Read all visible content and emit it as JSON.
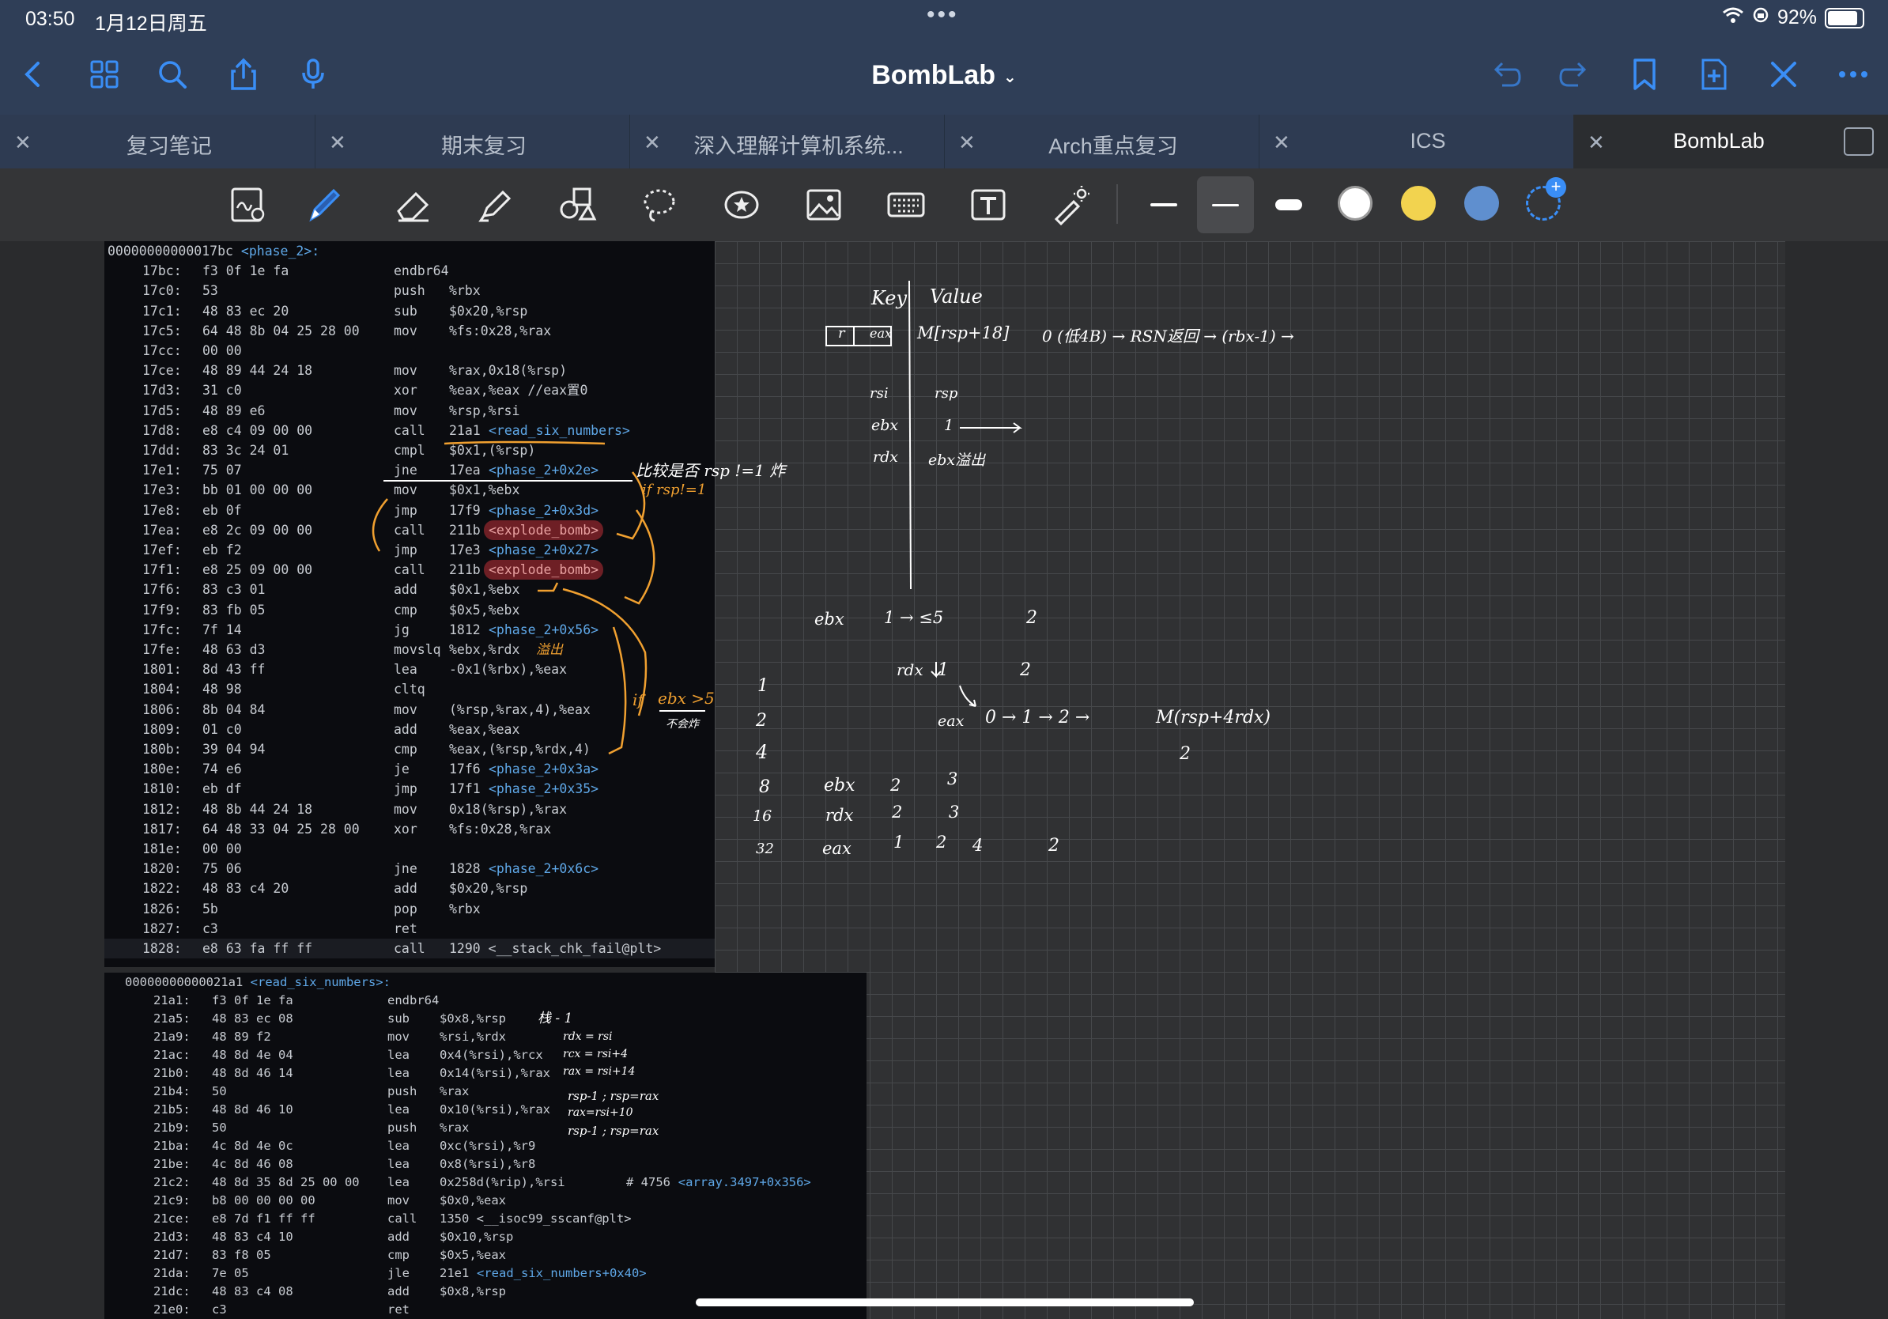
{
  "status": {
    "time": "03:50",
    "date": "1月12日周五",
    "battery": "92%",
    "battery_level": 0.92
  },
  "app": {
    "doc_title": "BombLab",
    "accent": "#3a8ef6"
  },
  "nav": {
    "left_icons": [
      "back-chevron-icon",
      "grid-icon",
      "search-icon",
      "share-icon",
      "microphone-icon"
    ],
    "right_icons": [
      "undo-icon",
      "redo-icon",
      "bookmark-icon",
      "add-page-icon",
      "close-x-icon",
      "more-icon"
    ]
  },
  "tabs": [
    {
      "label": "复习笔记",
      "active": false
    },
    {
      "label": "期末复习",
      "active": false
    },
    {
      "label": "深入理解计算机系统...",
      "active": false
    },
    {
      "label": "Arch重点复习",
      "active": false
    },
    {
      "label": "ICS",
      "active": false
    },
    {
      "label": "BombLab",
      "active": true
    }
  ],
  "toolbar": {
    "tools": [
      "page-zoom-icon",
      "pen-icon",
      "eraser-icon",
      "highlighter-icon",
      "shapes-icon",
      "lasso-icon",
      "stickers-icon",
      "image-icon",
      "keyboard-icon",
      "text-icon",
      "laser-pointer-icon"
    ],
    "colors": [
      "#ffffff",
      "#f2d34f",
      "#5f8fcf"
    ]
  },
  "code1": {
    "header_addr": "00000000000017bc",
    "header_sym": "<phase_2>:",
    "lines": [
      {
        "a": "17bc:",
        "b": "f3 0f 1e fa",
        "m": "endbr64",
        "o": ""
      },
      {
        "a": "17c0:",
        "b": "53",
        "m": "push",
        "o": "%rbx"
      },
      {
        "a": "17c1:",
        "b": "48 83 ec 20",
        "m": "sub",
        "o": "$0x20,%rsp"
      },
      {
        "a": "17c5:",
        "b": "64 48 8b 04 25 28 00",
        "m": "mov",
        "o": "%fs:0x28,%rax"
      },
      {
        "a": "17cc:",
        "b": "00 00",
        "m": "",
        "o": ""
      },
      {
        "a": "17ce:",
        "b": "48 89 44 24 18",
        "m": "mov",
        "o": "%rax,0x18(%rsp)"
      },
      {
        "a": "17d3:",
        "b": "31 c0",
        "m": "xor",
        "o": "%eax,%eax //eax置0"
      },
      {
        "a": "17d5:",
        "b": "48 89 e6",
        "m": "mov",
        "o": "%rsp,%rsi"
      },
      {
        "a": "17d8:",
        "b": "e8 c4 09 00 00",
        "m": "call",
        "o": "21a1",
        "s": "<read_six_numbers>"
      },
      {
        "a": "17dd:",
        "b": "83 3c 24 01",
        "m": "cmpl",
        "o": "$0x1,(%rsp)"
      },
      {
        "a": "17e1:",
        "b": "75 07",
        "m": "jne",
        "o": "17ea",
        "s": "<phase_2+0x2e>"
      },
      {
        "a": "17e3:",
        "b": "bb 01 00 00 00",
        "m": "mov",
        "o": "$0x1,%ebx"
      },
      {
        "a": "17e8:",
        "b": "eb 0f",
        "m": "jmp",
        "o": "17f9",
        "s": "<phase_2+0x3d>"
      },
      {
        "a": "17ea:",
        "b": "e8 2c 09 00 00",
        "m": "call",
        "o": "211b",
        "x": "<explode_bomb>"
      },
      {
        "a": "17ef:",
        "b": "eb f2",
        "m": "jmp",
        "o": "17e3",
        "s": "<phase_2+0x27>"
      },
      {
        "a": "17f1:",
        "b": "e8 25 09 00 00",
        "m": "call",
        "o": "211b",
        "x": "<explode_bomb>"
      },
      {
        "a": "17f6:",
        "b": "83 c3 01",
        "m": "add",
        "o": "$0x1,%ebx"
      },
      {
        "a": "17f9:",
        "b": "83 fb 05",
        "m": "cmp",
        "o": "$0x5,%ebx"
      },
      {
        "a": "17fc:",
        "b": "7f 14",
        "m": "jg",
        "o": "1812",
        "s": "<phase_2+0x56>"
      },
      {
        "a": "17fe:",
        "b": "48 63 d3",
        "m": "movslq",
        "o": "%ebx,%rdx"
      },
      {
        "a": "1801:",
        "b": "8d 43 ff",
        "m": "lea",
        "o": "-0x1(%rbx),%eax"
      },
      {
        "a": "1804:",
        "b": "48 98",
        "m": "cltq",
        "o": ""
      },
      {
        "a": "1806:",
        "b": "8b 04 84",
        "m": "mov",
        "o": "(%rsp,%rax,4),%eax"
      },
      {
        "a": "1809:",
        "b": "01 c0",
        "m": "add",
        "o": "%eax,%eax"
      },
      {
        "a": "180b:",
        "b": "39 04 94",
        "m": "cmp",
        "o": "%eax,(%rsp,%rdx,4)"
      },
      {
        "a": "180e:",
        "b": "74 e6",
        "m": "je",
        "o": "17f6",
        "s": "<phase_2+0x3a>"
      },
      {
        "a": "1810:",
        "b": "eb df",
        "m": "jmp",
        "o": "17f1",
        "s": "<phase_2+0x35>"
      },
      {
        "a": "1812:",
        "b": "48 8b 44 24 18",
        "m": "mov",
        "o": "0x18(%rsp),%rax"
      },
      {
        "a": "1817:",
        "b": "64 48 33 04 25 28 00",
        "m": "xor",
        "o": "%fs:0x28,%rax"
      },
      {
        "a": "181e:",
        "b": "00 00",
        "m": "",
        "o": ""
      },
      {
        "a": "1820:",
        "b": "75 06",
        "m": "jne",
        "o": "1828",
        "s": "<phase_2+0x6c>"
      },
      {
        "a": "1822:",
        "b": "48 83 c4 20",
        "m": "add",
        "o": "$0x20,%rsp"
      },
      {
        "a": "1826:",
        "b": "5b",
        "m": "pop",
        "o": "%rbx"
      },
      {
        "a": "1827:",
        "b": "c3",
        "m": "ret",
        "o": ""
      },
      {
        "a": "1828:",
        "b": "e8 63 fa ff ff",
        "m": "call",
        "o": "1290 <__stack_chk_fail@plt>"
      }
    ]
  },
  "code2": {
    "header_addr": "00000000000021a1",
    "header_sym": "<read_six_numbers>:",
    "lines": [
      {
        "a": "21a1:",
        "b": "f3 0f 1e fa",
        "m": "endbr64",
        "o": ""
      },
      {
        "a": "21a5:",
        "b": "48 83 ec 08",
        "m": "sub",
        "o": "$0x8,%rsp"
      },
      {
        "a": "21a9:",
        "b": "48 89 f2",
        "m": "mov",
        "o": "%rsi,%rdx"
      },
      {
        "a": "21ac:",
        "b": "48 8d 4e 04",
        "m": "lea",
        "o": "0x4(%rsi),%rcx"
      },
      {
        "a": "21b0:",
        "b": "48 8d 46 14",
        "m": "lea",
        "o": "0x14(%rsi),%rax"
      },
      {
        "a": "21b4:",
        "b": "50",
        "m": "push",
        "o": "%rax"
      },
      {
        "a": "21b5:",
        "b": "48 8d 46 10",
        "m": "lea",
        "o": "0x10(%rsi),%rax"
      },
      {
        "a": "21b9:",
        "b": "50",
        "m": "push",
        "o": "%rax"
      },
      {
        "a": "21ba:",
        "b": "4c 8d 4e 0c",
        "m": "lea",
        "o": "0xc(%rsi),%r9"
      },
      {
        "a": "21be:",
        "b": "4c 8d 46 08",
        "m": "lea",
        "o": "0x8(%rsi),%r8"
      },
      {
        "a": "21c2:",
        "b": "48 8d 35 8d 25 00 00",
        "m": "lea",
        "o": "0x258d(%rip),%rsi",
        "c": "# 4756",
        "s": "<array.3497+0x356>"
      },
      {
        "a": "21c9:",
        "b": "b8 00 00 00 00",
        "m": "mov",
        "o": "$0x0,%eax"
      },
      {
        "a": "21ce:",
        "b": "e8 7d f1 ff ff",
        "m": "call",
        "o": "1350 <__isoc99_sscanf@plt>"
      },
      {
        "a": "21d3:",
        "b": "48 83 c4 10",
        "m": "add",
        "o": "$0x10,%rsp"
      },
      {
        "a": "21d7:",
        "b": "83 f8 05",
        "m": "cmp",
        "o": "$0x5,%eax"
      },
      {
        "a": "21da:",
        "b": "7e 05",
        "m": "jle",
        "o": "21e1",
        "s": "<read_six_numbers+0x40>"
      },
      {
        "a": "21dc:",
        "b": "48 83 c4 08",
        "m": "add",
        "o": "$0x8,%rsp"
      },
      {
        "a": "21e0:",
        "b": "c3",
        "m": "ret",
        "o": ""
      }
    ]
  },
  "handwriting": {
    "phase2_notes": [
      "比较是否 rsp !=1 炸",
      "if rsp!=1",
      "溢出",
      "if",
      "ebx >5",
      "不会炸"
    ],
    "read_six_notes": [
      "栈 - 1",
      "rdx = rsi",
      "rcx = rsi+4",
      "rax = rsi+14",
      "rsp-1 ; rsp=rax",
      "rax=rsi+10",
      "rsp-1 ; rsp=rax"
    ],
    "kv": {
      "key": "Key",
      "value": "Value",
      "row1_key_a": "r",
      "row1_key_b": "eax",
      "row1_val": "M[rsp+18]",
      "row1_chain": "0 (低4B) → RSN返回 → (rbx-1) →",
      "row2_key": "rsi",
      "row2_val": "rsp",
      "row3_key": "ebx",
      "row3_val": "1",
      "row4_key": "rdx",
      "row4_val": "ebx溢出"
    },
    "trace": [
      "ebx",
      "1 → ≤5",
      "2",
      "rdx",
      "1",
      "2",
      "eax",
      "0 → 1 → 2 →",
      "M(rsp+4rdx)",
      "2",
      "1",
      "2",
      "4",
      "8",
      "16",
      "32",
      "ebx",
      "2",
      "3",
      "rdx",
      "2",
      "3",
      "eax",
      "1",
      "2",
      "4",
      "2"
    ]
  }
}
